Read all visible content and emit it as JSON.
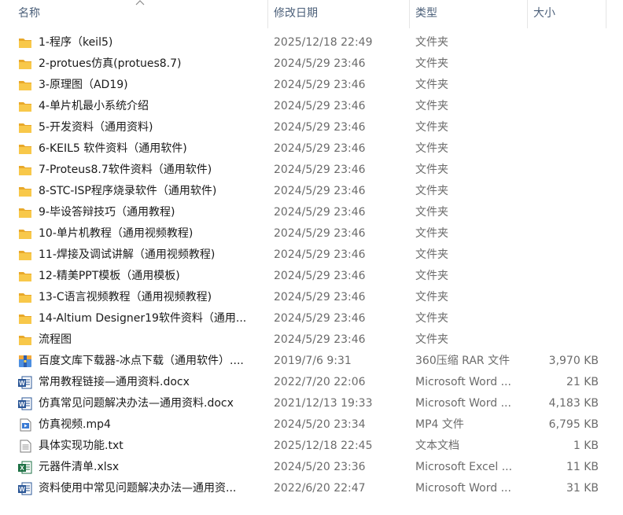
{
  "columns": {
    "name": "名称",
    "date": "修改日期",
    "type": "类型",
    "size": "大小"
  },
  "files": [
    {
      "icon": "folder-icon",
      "name": "1-程序（keil5)",
      "date": "2025/12/18 22:49",
      "type": "文件夹",
      "size": ""
    },
    {
      "icon": "folder-icon",
      "name": "2-protues仿真(protues8.7)",
      "date": "2024/5/29 23:46",
      "type": "文件夹",
      "size": ""
    },
    {
      "icon": "folder-icon",
      "name": "3-原理图（AD19)",
      "date": "2024/5/29 23:46",
      "type": "文件夹",
      "size": ""
    },
    {
      "icon": "folder-icon",
      "name": "4-单片机最小系统介绍",
      "date": "2024/5/29 23:46",
      "type": "文件夹",
      "size": ""
    },
    {
      "icon": "folder-icon",
      "name": "5-开发资料（通用资料)",
      "date": "2024/5/29 23:46",
      "type": "文件夹",
      "size": ""
    },
    {
      "icon": "folder-icon",
      "name": "6-KEIL5 软件资料（通用软件)",
      "date": "2024/5/29 23:46",
      "type": "文件夹",
      "size": ""
    },
    {
      "icon": "folder-icon",
      "name": "7-Proteus8.7软件资料（通用软件)",
      "date": "2024/5/29 23:46",
      "type": "文件夹",
      "size": ""
    },
    {
      "icon": "folder-icon",
      "name": "8-STC-ISP程序烧录软件（通用软件)",
      "date": "2024/5/29 23:46",
      "type": "文件夹",
      "size": ""
    },
    {
      "icon": "folder-icon",
      "name": "9-毕设答辩技巧（通用教程)",
      "date": "2024/5/29 23:46",
      "type": "文件夹",
      "size": ""
    },
    {
      "icon": "folder-icon",
      "name": "10-单片机教程（通用视频教程)",
      "date": "2024/5/29 23:46",
      "type": "文件夹",
      "size": ""
    },
    {
      "icon": "folder-icon",
      "name": "11-焊接及调试讲解（通用视频教程)",
      "date": "2024/5/29 23:46",
      "type": "文件夹",
      "size": ""
    },
    {
      "icon": "folder-icon",
      "name": "12-精美PPT模板（通用模板)",
      "date": "2024/5/29 23:46",
      "type": "文件夹",
      "size": ""
    },
    {
      "icon": "folder-icon",
      "name": "13-C语言视频教程（通用视频教程)",
      "date": "2024/5/29 23:46",
      "type": "文件夹",
      "size": ""
    },
    {
      "icon": "folder-icon",
      "name": "14-Altium Designer19软件资料（通用...",
      "date": "2024/5/29 23:46",
      "type": "文件夹",
      "size": ""
    },
    {
      "icon": "folder-icon",
      "name": "流程图",
      "date": "2024/5/29 23:46",
      "type": "文件夹",
      "size": ""
    },
    {
      "icon": "rar-archive-icon",
      "name": "百度文库下载器-冰点下载（通用软件）....",
      "date": "2019/7/6 9:31",
      "type": "360压缩 RAR 文件",
      "size": "3,970 KB"
    },
    {
      "icon": "word-doc-icon",
      "name": "常用教程链接—通用资料.docx",
      "date": "2022/7/20 22:06",
      "type": "Microsoft Word ...",
      "size": "21 KB"
    },
    {
      "icon": "word-doc-icon",
      "name": "仿真常见问题解决办法—通用资料.docx",
      "date": "2021/12/13 19:33",
      "type": "Microsoft Word ...",
      "size": "4,183 KB"
    },
    {
      "icon": "video-file-icon",
      "name": "仿真视频.mp4",
      "date": "2024/5/20 23:34",
      "type": "MP4 文件",
      "size": "6,795 KB"
    },
    {
      "icon": "text-file-icon",
      "name": "具体实现功能.txt",
      "date": "2025/12/18 22:45",
      "type": "文本文档",
      "size": "1 KB"
    },
    {
      "icon": "excel-sheet-icon",
      "name": "元器件清单.xlsx",
      "date": "2024/5/20 23:36",
      "type": "Microsoft Excel ...",
      "size": "11 KB"
    },
    {
      "icon": "word-doc-icon",
      "name": "资料使用中常见问题解决办法—通用资...",
      "date": "2022/6/20 22:47",
      "type": "Microsoft Word ...",
      "size": "31 KB"
    }
  ],
  "colors": {
    "header_text": "#4c607a",
    "folder": "#f8c84a",
    "word": "#2b5797",
    "excel": "#1e7145"
  }
}
